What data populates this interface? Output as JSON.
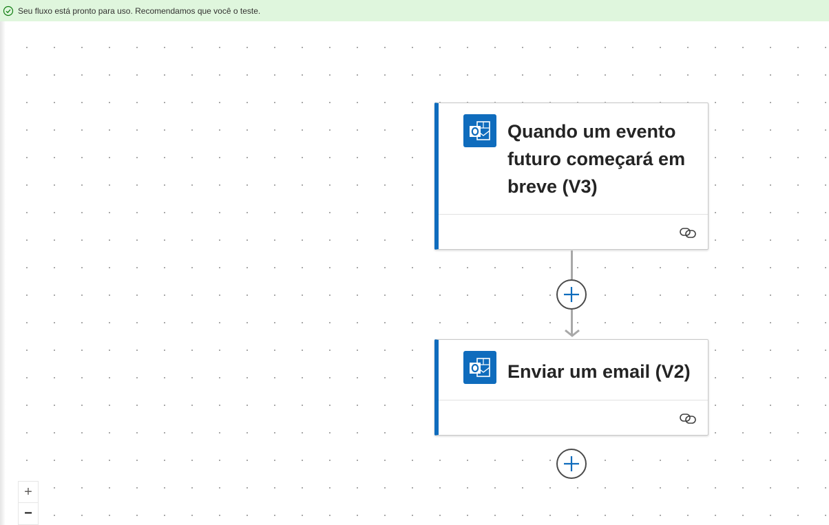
{
  "banner": {
    "message": "Seu fluxo está pronto para uso. Recomendamos que você o teste.",
    "icon": "check-circle-icon",
    "background": "#dff6dd",
    "icon_color": "#107c10"
  },
  "flow": {
    "steps": [
      {
        "title": "Quando um evento futuro começará em breve (V3)",
        "icon": "outlook-icon",
        "footer_icon": "link-icon",
        "accent": "#0f6cbd"
      },
      {
        "title": "Enviar um email (V2)",
        "icon": "outlook-icon",
        "footer_icon": "link-icon",
        "accent": "#0f6cbd"
      }
    ],
    "add_step_icon": "plus-icon"
  },
  "zoom": {
    "in_label": "+",
    "out_label": "−"
  }
}
